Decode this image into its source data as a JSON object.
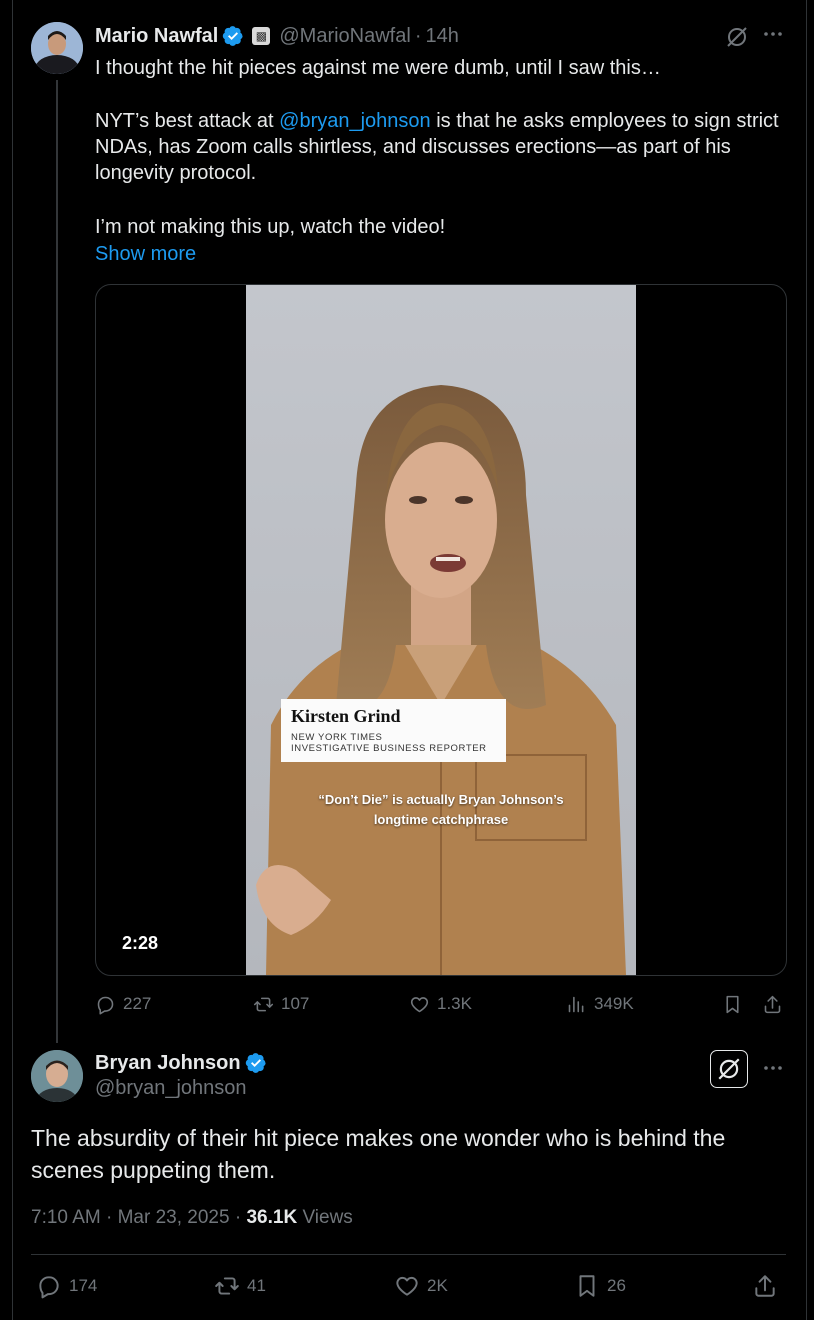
{
  "parent_tweet": {
    "author_name": "Mario Nawfal",
    "handle": "@MarioNawfal",
    "time_separator": "·",
    "time": "14h",
    "paragraphs": {
      "p1": "I thought the hit pieces against me were dumb, until I saw this…",
      "p2_before": "NYT’s best attack at ",
      "p2_mention": "@bryan_johnson",
      "p2_after": "  is that he asks employees to sign strict NDAs, has Zoom calls shirtless, and discusses erections—as part of his longevity protocol.",
      "p3": "I’m not making this up, watch the video!"
    },
    "show_more": "Show more",
    "video": {
      "lower_third_name": "Kirsten Grind",
      "lower_third_org": "NEW YORK TIMES",
      "lower_third_role": "INVESTIGATIVE BUSINESS REPORTER",
      "caption_line1": "“Don’t Die” is actually Bryan Johnson’s",
      "caption_line2": "longtime catchphrase",
      "duration": "2:28"
    },
    "stats": {
      "replies": "227",
      "reposts": "107",
      "likes": "1.3K",
      "views": "349K"
    }
  },
  "main_tweet": {
    "author_name": "Bryan Johnson",
    "handle": "@bryan_johnson",
    "text": "The absurdity of their hit piece makes one wonder who is behind the scenes puppeting them.",
    "time": "7:10 AM",
    "date": "Mar 23, 2025",
    "sep": "·",
    "views_count": "36.1K",
    "views_label": "Views",
    "stats": {
      "replies": "174",
      "reposts": "41",
      "likes": "2K",
      "bookmarks": "26"
    }
  },
  "colors": {
    "background": "#000000",
    "text_primary": "#e7e9ea",
    "text_secondary": "#71767b",
    "accent": "#1d9bf0",
    "border": "#2f3336"
  },
  "icons": [
    "verified-badge-icon",
    "grok-icon",
    "more-icon",
    "reply-icon",
    "repost-icon",
    "like-icon",
    "views-icon",
    "bookmark-icon",
    "share-icon"
  ]
}
